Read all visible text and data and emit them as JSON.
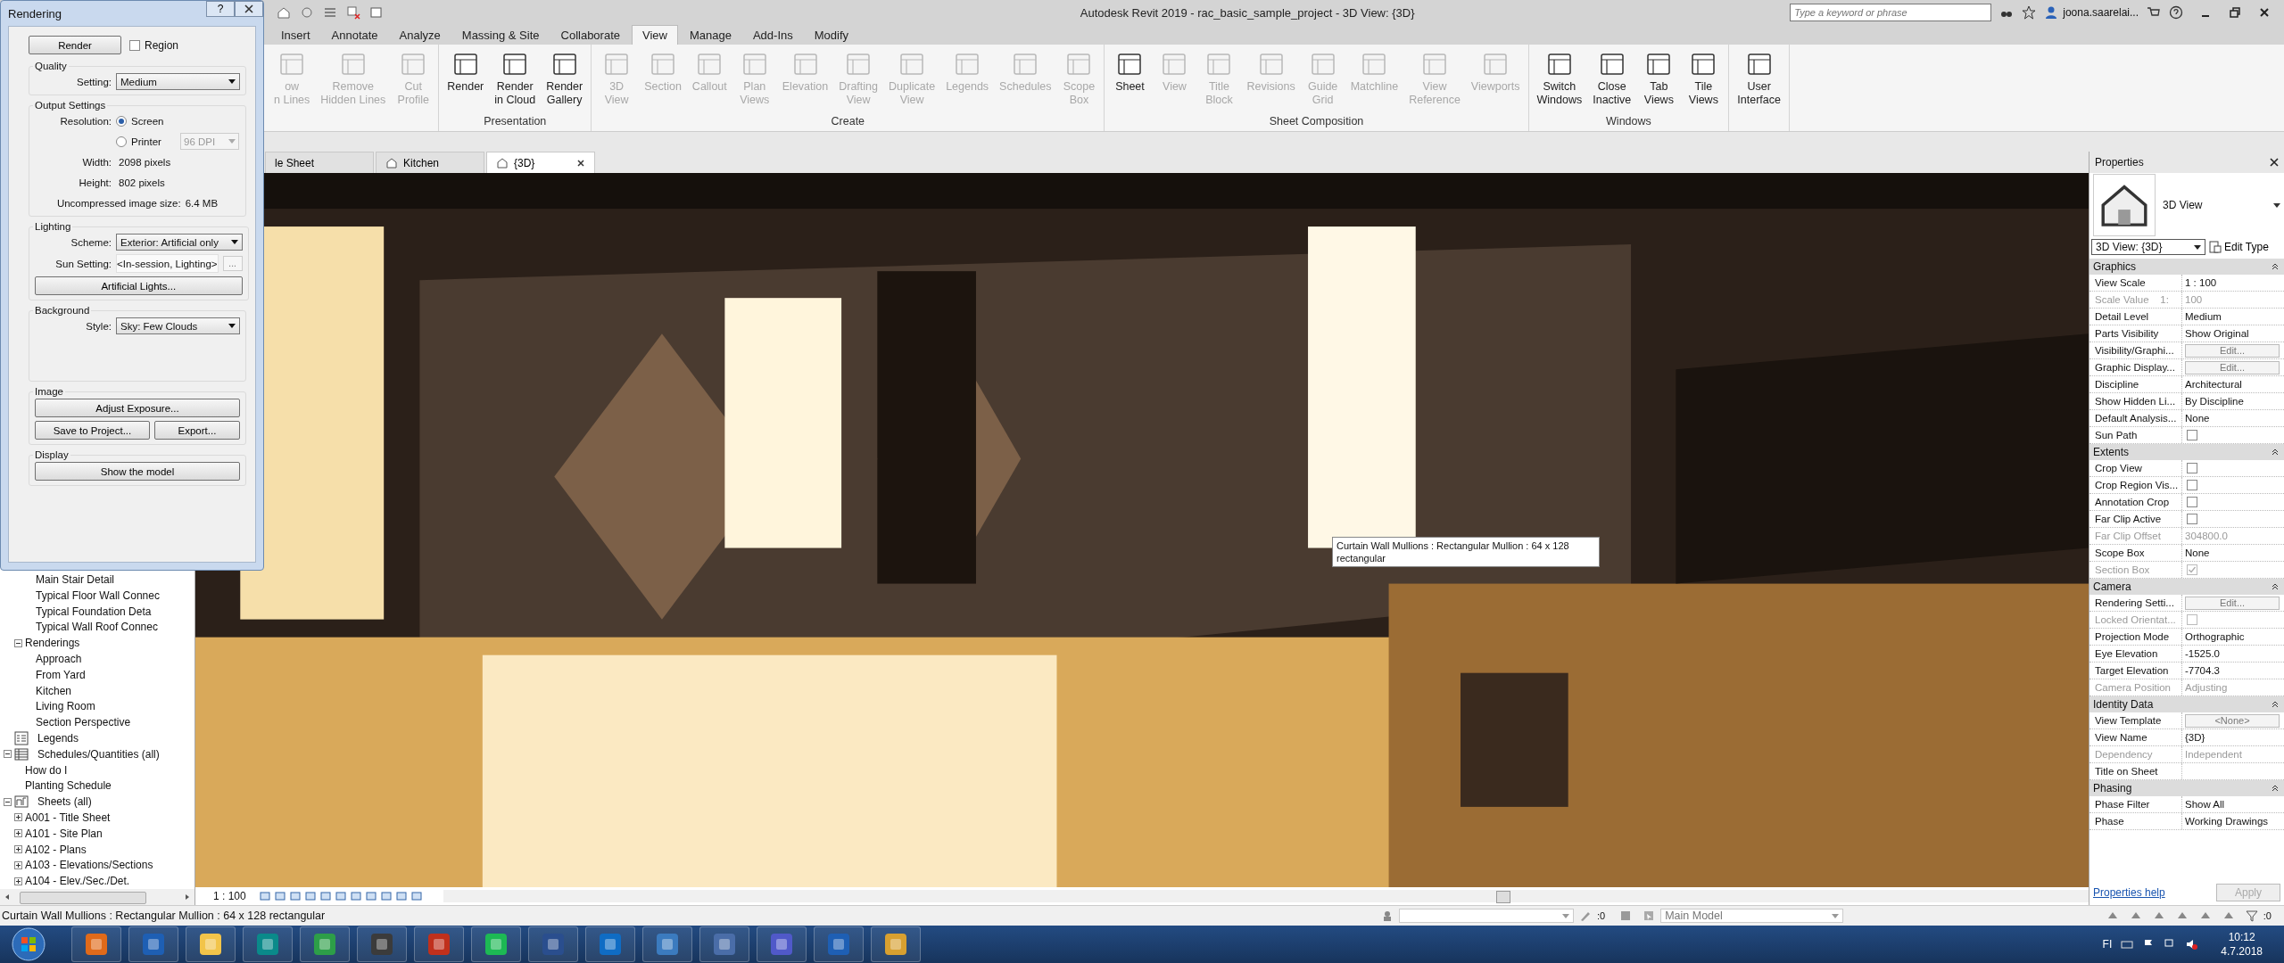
{
  "window": {
    "title": "Autodesk Revit 2019 - rac_basic_sample_project - 3D View: {3D}",
    "search_placeholder": "Type a keyword or phrase",
    "user": "joona.saarelai..."
  },
  "ribbon_tabs": [
    {
      "label": "Insert",
      "selected": false
    },
    {
      "label": "Annotate",
      "selected": false
    },
    {
      "label": "Analyze",
      "selected": false
    },
    {
      "label": "Massing & Site",
      "selected": false
    },
    {
      "label": "Collaborate",
      "selected": false
    },
    {
      "label": "View",
      "selected": true
    },
    {
      "label": "Manage",
      "selected": false
    },
    {
      "label": "Add-Ins",
      "selected": false
    },
    {
      "label": "Modify",
      "selected": false
    }
  ],
  "ribbon_panels": [
    {
      "tools": [
        {
          "label": "ow\nn Lines",
          "enabled": false
        },
        {
          "label": "Remove\nHidden Lines",
          "enabled": false
        },
        {
          "label": "Cut\nProfile",
          "enabled": false
        }
      ]
    },
    {
      "title": "Presentation",
      "tools": [
        {
          "label": "Render",
          "enabled": true
        },
        {
          "label": "Render\nin Cloud",
          "enabled": true
        },
        {
          "label": "Render\nGallery",
          "enabled": true
        }
      ]
    },
    {
      "title": "Create",
      "tools": [
        {
          "label": "3D\nView",
          "enabled": false
        },
        {
          "label": "Section",
          "enabled": false
        },
        {
          "label": "Callout",
          "enabled": false
        },
        {
          "label": "Plan\nViews",
          "enabled": false
        },
        {
          "label": "Elevation",
          "enabled": false
        },
        {
          "label": "Drafting\nView",
          "enabled": false
        },
        {
          "label": "Duplicate\nView",
          "enabled": false
        },
        {
          "label": "Legends",
          "enabled": false
        },
        {
          "label": "Schedules",
          "enabled": false
        },
        {
          "label": "Scope\nBox",
          "enabled": false
        }
      ]
    },
    {
      "title": "Sheet Composition",
      "tools": [
        {
          "label": "Sheet",
          "enabled": true
        },
        {
          "label": "View",
          "enabled": false
        },
        {
          "label": "Title\nBlock",
          "enabled": false
        },
        {
          "label": "Revisions",
          "enabled": false
        },
        {
          "label": "Guide\nGrid",
          "enabled": false
        },
        {
          "label": "Matchline",
          "enabled": false
        },
        {
          "label": "View\nReference",
          "enabled": false
        },
        {
          "label": "Viewports",
          "enabled": false
        }
      ]
    },
    {
      "title": "Windows",
      "tools": [
        {
          "label": "Switch\nWindows",
          "enabled": true
        },
        {
          "label": "Close\nInactive",
          "enabled": true
        },
        {
          "label": "Tab\nViews",
          "enabled": true
        },
        {
          "label": "Tile\nViews",
          "enabled": true
        }
      ]
    },
    {
      "tools": [
        {
          "label": "User\nInterface",
          "enabled": true
        }
      ]
    }
  ],
  "rendering_dialog": {
    "title": "Rendering",
    "help": "?",
    "render_button": "Render",
    "region": {
      "label": "Region",
      "checked": false
    },
    "quality": {
      "title": "Quality",
      "setting_label": "Setting:",
      "setting": "Medium"
    },
    "output": {
      "title": "Output Settings",
      "resolution_label": "Resolution:",
      "options": [
        {
          "label": "Screen",
          "selected": true
        },
        {
          "label": "Printer",
          "selected": false
        }
      ],
      "dpi": "96 DPI",
      "dpi_disabled": true,
      "width_label": "Width:",
      "width": "2098 pixels",
      "height_label": "Height:",
      "height": "802 pixels",
      "size_label": "Uncompressed image size:",
      "size": "6.4 MB"
    },
    "lighting": {
      "title": "Lighting",
      "scheme_label": "Scheme:",
      "scheme": "Exterior: Artificial only",
      "sun_label": "Sun Setting:",
      "sun": "<In-session, Lighting>",
      "more": "...",
      "lights_button": "Artificial Lights..."
    },
    "background": {
      "title": "Background",
      "style_label": "Style:",
      "style": "Sky: Few Clouds"
    },
    "image": {
      "title": "Image",
      "exposure_button": "Adjust Exposure...",
      "save_button": "Save to Project...",
      "export_button": "Export..."
    },
    "display": {
      "title": "Display",
      "button": "Show the model"
    }
  },
  "browser": {
    "items": [
      {
        "children": [
          {
            "children": [
              {
                "label": "Main Stair Detail"
              },
              {
                "label": "Typical Floor Wall Connec"
              },
              {
                "label": "Typical Foundation Deta"
              },
              {
                "label": "Typical Wall Roof Connec"
              }
            ]
          },
          {
            "label": "Renderings",
            "expanded": true,
            "children": [
              {
                "label": "Approach"
              },
              {
                "label": "From Yard"
              },
              {
                "label": "Kitchen"
              },
              {
                "label": "Living Room"
              },
              {
                "label": "Section Perspective"
              }
            ]
          }
        ]
      },
      {
        "label": "Legends",
        "kind": "legend"
      },
      {
        "label": "Schedules/Quantities (all)",
        "kind": "schedule",
        "expanded": true,
        "children": [
          {
            "label": "How do I"
          },
          {
            "label": "Planting Schedule"
          }
        ]
      },
      {
        "label": "Sheets (all)",
        "kind": "sheet",
        "expanded": true,
        "children": [
          {
            "label": "A001 - Title Sheet",
            "expanded": false
          },
          {
            "label": "A101 - Site Plan",
            "expanded": false
          },
          {
            "label": "A102 - Plans",
            "expanded": false
          },
          {
            "label": "A103 - Elevations/Sections",
            "expanded": false
          },
          {
            "label": "A104 - Elev./Sec./Det.",
            "expanded": false
          }
        ]
      }
    ]
  },
  "view_tabs": [
    {
      "label": "le Sheet",
      "selected": false
    },
    {
      "label": "Kitchen",
      "selected": false
    },
    {
      "label": "{3D}",
      "selected": true
    }
  ],
  "viewport": {
    "kind": "picture",
    "tooltip": "Curtain Wall Mullions : Rectangular Mullion : 64 x 128 rectangular",
    "scale": "1 : 100"
  },
  "properties": {
    "title": "Properties",
    "type_name": "3D View",
    "selector": "3D View: {3D}",
    "edit_type": "Edit Type",
    "groups": [
      {
        "title": "Graphics",
        "rows": [
          {
            "label": "View Scale",
            "kind": "text",
            "value": "1 : 100",
            "disabled": false
          },
          {
            "label": "Scale Value    1:",
            "kind": "text",
            "value": "100",
            "disabled": true
          },
          {
            "label": "Detail Level",
            "kind": "text",
            "value": "Medium",
            "disabled": false
          },
          {
            "label": "Parts Visibility",
            "kind": "text",
            "value": "Show Original",
            "disabled": false
          },
          {
            "label": "Visibility/Graphi...",
            "kind": "button",
            "value": "Edit...",
            "disabled": false
          },
          {
            "label": "Graphic Display...",
            "kind": "button",
            "value": "Edit...",
            "disabled": false
          },
          {
            "label": "Discipline",
            "kind": "text",
            "value": "Architectural",
            "disabled": false
          },
          {
            "label": "Show Hidden Li...",
            "kind": "text",
            "value": "By Discipline",
            "disabled": false
          },
          {
            "label": "Default Analysis...",
            "kind": "text",
            "value": "None",
            "disabled": false
          },
          {
            "label": "Sun Path",
            "kind": "check",
            "checked": false,
            "disabled": false
          }
        ]
      },
      {
        "title": "Extents",
        "rows": [
          {
            "label": "Crop View",
            "kind": "check",
            "checked": false,
            "disabled": false
          },
          {
            "label": "Crop Region Vis...",
            "kind": "check",
            "checked": false,
            "disabled": false
          },
          {
            "label": "Annotation Crop",
            "kind": "check",
            "checked": false,
            "disabled": false
          },
          {
            "label": "Far Clip Active",
            "kind": "check",
            "checked": false,
            "disabled": false
          },
          {
            "label": "Far Clip Offset",
            "kind": "text",
            "value": "304800.0",
            "disabled": true
          },
          {
            "label": "Scope Box",
            "kind": "text",
            "value": "None",
            "disabled": false
          },
          {
            "label": "Section Box",
            "kind": "check",
            "checked": true,
            "disabled": true
          }
        ]
      },
      {
        "title": "Camera",
        "rows": [
          {
            "label": "Rendering Setti...",
            "kind": "button",
            "value": "Edit...",
            "disabled": false
          },
          {
            "label": "Locked Orientat...",
            "kind": "check",
            "checked": false,
            "disabled": true
          },
          {
            "label": "Projection Mode",
            "kind": "text",
            "value": "Orthographic",
            "disabled": false
          },
          {
            "label": "Eye Elevation",
            "kind": "text",
            "value": "-1525.0",
            "disabled": false
          },
          {
            "label": "Target Elevation",
            "kind": "text",
            "value": "-7704.3",
            "disabled": false
          },
          {
            "label": "Camera Position",
            "kind": "text",
            "value": "Adjusting",
            "disabled": true
          }
        ]
      },
      {
        "title": "Identity Data",
        "rows": [
          {
            "label": "View Template",
            "kind": "button",
            "value": "<None>",
            "disabled": false
          },
          {
            "label": "View Name",
            "kind": "text",
            "value": "{3D}",
            "disabled": false
          },
          {
            "label": "Dependency",
            "kind": "text",
            "value": "Independent",
            "disabled": true
          },
          {
            "label": "Title on Sheet",
            "kind": "text",
            "disabled": false
          }
        ]
      },
      {
        "title": "Phasing",
        "rows": [
          {
            "label": "Phase Filter",
            "kind": "text",
            "value": "Show All",
            "disabled": false
          },
          {
            "label": "Phase",
            "kind": "text",
            "value": "Working Drawings",
            "disabled": false
          }
        ]
      }
    ],
    "help_link": "Properties help",
    "apply": "Apply",
    "apply_disabled": true
  },
  "status_bar": {
    "text": "Curtain Wall Mullions : Rectangular Mullion : 64 x 128 rectangular",
    "count_left": ":0",
    "workset": "Main Model",
    "count_right": ":0"
  },
  "taskbar": {
    "language": "FI",
    "time": "10:12",
    "date": "4.7.2018"
  }
}
